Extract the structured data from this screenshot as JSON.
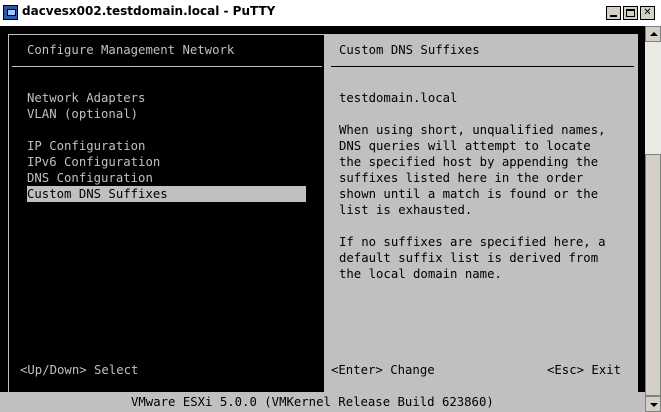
{
  "window": {
    "title": "dacvesx002.testdomain.local - PuTTY",
    "icon": "putty-icon",
    "controls": {
      "minimize": "minimize-icon",
      "maximize": "maximize-icon",
      "close": "✕"
    }
  },
  "left_pane": {
    "title": "Configure Management Network",
    "menu": [
      "Network Adapters",
      "VLAN (optional)",
      "IP Configuration",
      "IPv6 Configuration",
      "DNS Configuration",
      "Custom DNS Suffixes"
    ],
    "selected_index": 5,
    "footer": "<Up/Down> Select"
  },
  "right_pane": {
    "title": "Custom DNS Suffixes",
    "value": "testdomain.local",
    "description_lines": [
      "When using short, unqualified names,",
      "DNS queries will attempt to locate",
      "the specified host by appending the",
      "suffixes listed here in the order",
      "shown until a match is found or the",
      "list is exhausted."
    ],
    "note_lines": [
      "If no suffixes are specified here, a",
      "default suffix list is derived from",
      "the local domain name."
    ],
    "footer_left": "<Enter> Change",
    "footer_right": "<Esc> Exit"
  },
  "status_bar": {
    "text": "VMware ESXi 5.0.0 (VMKernel Release Build 623860)"
  },
  "colors": {
    "console_bg": "#000000",
    "console_fg": "#c0c0c0",
    "window_chrome": "#d4d0c8"
  }
}
